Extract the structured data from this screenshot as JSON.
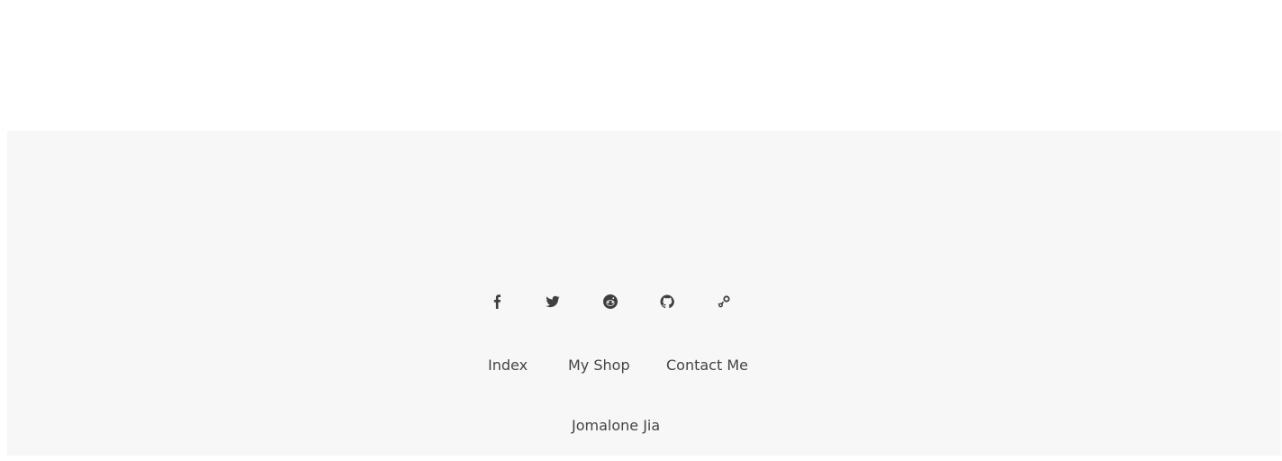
{
  "footer": {
    "social": [
      {
        "icon": "facebook-icon"
      },
      {
        "icon": "twitter-icon"
      },
      {
        "icon": "reddit-icon"
      },
      {
        "icon": "github-icon"
      },
      {
        "icon": "steam-icon"
      }
    ],
    "nav": {
      "index_label": "Index",
      "shop_label": "My Shop",
      "contact_label": "Contact Me"
    },
    "author": "Jomalone Jia",
    "background_color": "#f7f7f7",
    "text_color": "#444444"
  }
}
